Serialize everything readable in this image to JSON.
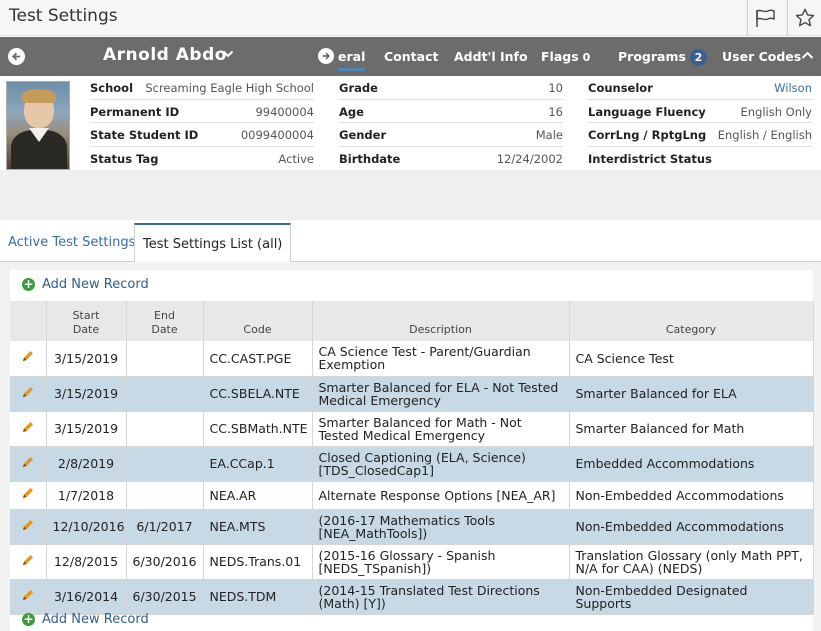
{
  "window": {
    "title": "Test Settings"
  },
  "student": {
    "name": "Arnold Abdo",
    "nav_tabs": [
      {
        "label": "eral",
        "active": true
      },
      {
        "label": "Contact"
      },
      {
        "label": "Addt'l Info"
      },
      {
        "label": "Flags",
        "badge": "0"
      },
      {
        "label": "Programs",
        "badge": "2"
      },
      {
        "label": "User Codes"
      }
    ]
  },
  "info": {
    "col1": [
      {
        "label": "School",
        "value": "Screaming Eagle High School"
      },
      {
        "label": "Permanent ID",
        "value": "99400004"
      },
      {
        "label": "State Student ID",
        "value": "0099400004"
      },
      {
        "label": "Status Tag",
        "value": "Active"
      }
    ],
    "col2": [
      {
        "label": "Grade",
        "value": "10"
      },
      {
        "label": "Age",
        "value": "16"
      },
      {
        "label": "Gender",
        "value": "Male"
      },
      {
        "label": "Birthdate",
        "value": "12/24/2002"
      }
    ],
    "col3": [
      {
        "label": "Counselor",
        "value": "Wilson"
      },
      {
        "label": "Language Fluency",
        "value": "English Only"
      },
      {
        "label": "CorrLng / RptgLng",
        "value": "English / English"
      },
      {
        "label": "Interdistrict Status",
        "value": ""
      }
    ]
  },
  "tabs": [
    {
      "label": "Active Test Settings"
    },
    {
      "label": "Test Settings List (all)"
    }
  ],
  "add_new_label": "Add New Record",
  "table": {
    "headers": [
      "",
      "Start\nDate",
      "End\nDate",
      "Code",
      "Description",
      "Category"
    ],
    "rows": [
      {
        "start": "3/15/2019",
        "end": "",
        "code": "CC.CAST.PGE",
        "desc": "CA Science Test - Parent/Guardian Exemption",
        "cat": "CA Science Test"
      },
      {
        "start": "3/15/2019",
        "end": "",
        "code": "CC.SBELA.NTE",
        "desc": "Smarter Balanced for ELA - Not Tested Medical Emergency",
        "cat": "Smarter Balanced for ELA"
      },
      {
        "start": "3/15/2019",
        "end": "",
        "code": "CC.SBMath.NTE",
        "desc": "Smarter Balanced for Math - Not Tested Medical Emergency",
        "cat": "Smarter Balanced for Math"
      },
      {
        "start": "2/8/2019",
        "end": "",
        "code": "EA.CCap.1",
        "desc": "Closed Captioning (ELA, Science) [TDS_ClosedCap1]",
        "cat": "Embedded Accommodations"
      },
      {
        "start": "1/7/2018",
        "end": "",
        "code": "NEA.AR",
        "desc": "Alternate Response Options [NEA_AR]",
        "cat": "Non-Embedded Accommodations"
      },
      {
        "start": "12/10/2016",
        "end": "6/1/2017",
        "code": "NEA.MTS",
        "desc": "(2016-17 Mathematics Tools [NEA_MathTools])",
        "cat": "Non-Embedded Accommodations"
      },
      {
        "start": "12/8/2015",
        "end": "6/30/2016",
        "code": "NEDS.Trans.01",
        "desc": "(2015-16 Glossary - Spanish [NEDS_TSpanish])",
        "cat": "Translation Glossary (only Math PPT, N/A for CAA) (NEDS)"
      },
      {
        "start": "3/16/2014",
        "end": "6/30/2015",
        "code": "NEDS.TDM",
        "desc": "(2014-15 Translated Test Directions (Math) [Y])",
        "cat": "Non-Embedded Designated Supports"
      }
    ]
  },
  "colors": {
    "title_bg": "#f6f6f6",
    "student_bar": "#6c6c6c",
    "row_alt": "#c7d9e5",
    "link": "#3a6ea5",
    "add_icon": "#3c9b3c",
    "edit_icon": "#e8961e"
  }
}
